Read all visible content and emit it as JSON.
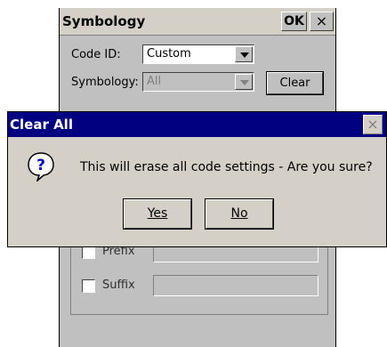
{
  "window": {
    "title": "Symbology",
    "ok_label": "OK",
    "close_label": "×",
    "code_id_label": "Code ID:",
    "code_id_value": "Custom",
    "symbology_label": "Symbology:",
    "symbology_value": "All",
    "clear_label": "Clear",
    "prefix_label": "Prefix",
    "suffix_label": "Suffix"
  },
  "dialog": {
    "title": "Clear All",
    "close_label": "×",
    "icon": "question-icon",
    "message": "This will erase all code settings - Are you sure?",
    "yes_label": "Yes",
    "no_label": "No"
  },
  "colors": {
    "dialog_titlebar": "#000080",
    "face": "#c0c0c0"
  }
}
